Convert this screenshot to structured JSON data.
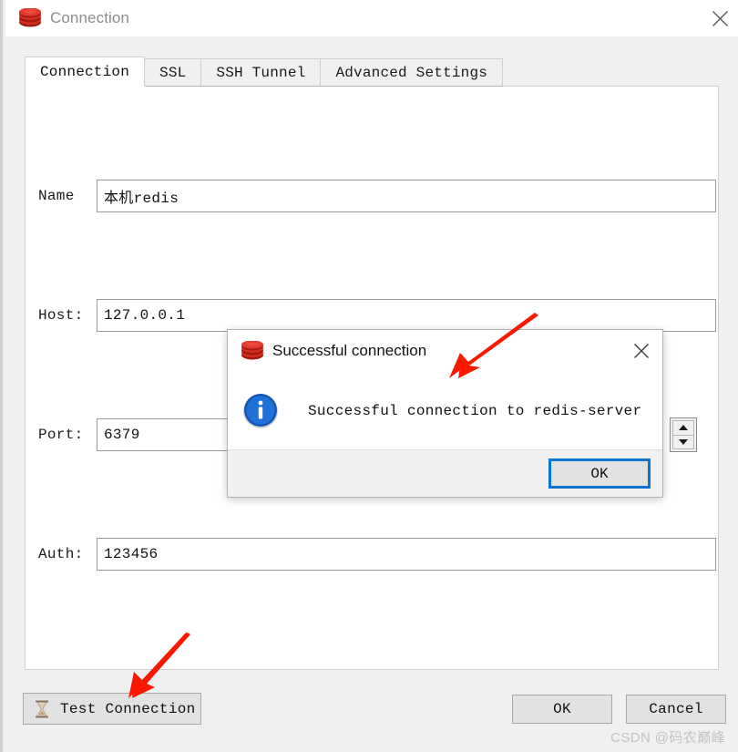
{
  "window": {
    "title": "Connection",
    "logo_icon": "redis-logo-icon",
    "close_icon": "close-icon"
  },
  "tabs": [
    {
      "label": "Connection",
      "active": true
    },
    {
      "label": "SSL",
      "active": false
    },
    {
      "label": "SSH Tunnel",
      "active": false
    },
    {
      "label": "Advanced Settings",
      "active": false
    }
  ],
  "form": {
    "name": {
      "label": "Name",
      "value": "本机redis",
      "placeholder": ""
    },
    "host": {
      "label": "Host:",
      "value": "127.0.0.1",
      "placeholder": ""
    },
    "port": {
      "label": "Port:",
      "value": "6379",
      "placeholder": "",
      "spinner_up_icon": "triangle-up-icon",
      "spinner_down_icon": "triangle-down-icon"
    },
    "auth": {
      "label": "Auth:",
      "value": "123456",
      "placeholder": ""
    }
  },
  "footer": {
    "test_connection_label": "Test Connection",
    "test_connection_icon": "hourglass-icon",
    "ok_label": "OK",
    "cancel_label": "Cancel"
  },
  "modal": {
    "title": "Successful connection",
    "logo_icon": "redis-logo-icon",
    "close_icon": "close-icon",
    "info_icon": "info-circle-icon",
    "message": "Successful connection to redis-server",
    "ok_label": "OK"
  },
  "annotations": {
    "arrow_top": "red-arrow-icon",
    "arrow_bottom": "red-arrow-icon"
  },
  "watermark": "CSDN @码农巅峰",
  "colors": {
    "accent_blue": "#0a74d0",
    "redis_red": "#d82c20",
    "annotation_red": "#fa1800",
    "panel_bg": "#f0f0f0",
    "field_bg": "#ffffff"
  }
}
